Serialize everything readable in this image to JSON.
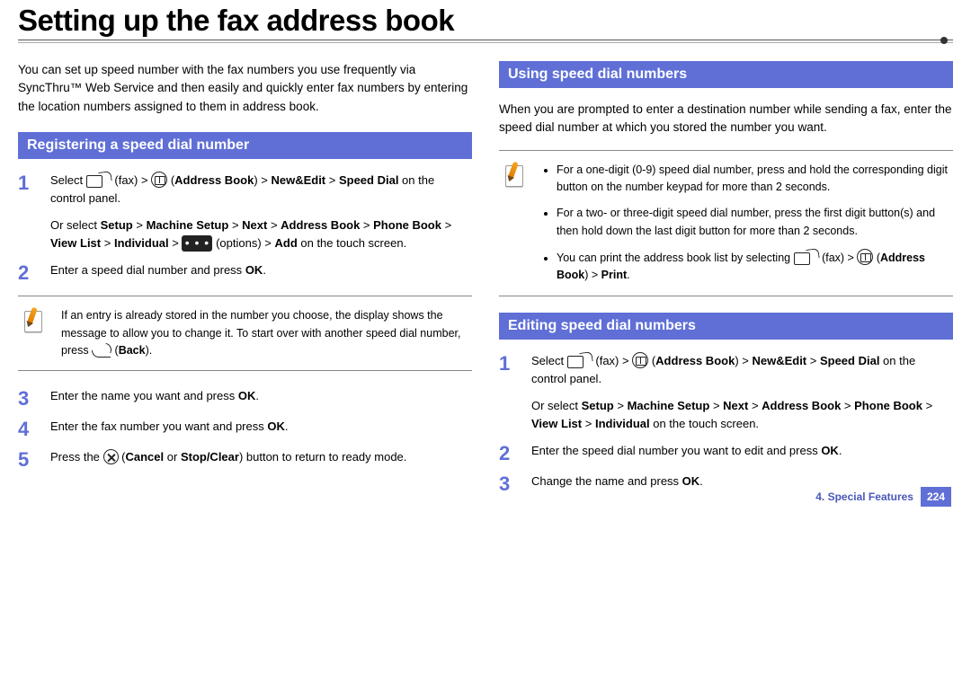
{
  "page_title": "Setting up the fax address book",
  "intro": "You can set up speed number with the fax numbers you use frequently via SyncThru™ Web Service and then easily and quickly enter fax numbers by entering the location numbers assigned to them in address book.",
  "left": {
    "heading": "Registering a speed dial number",
    "steps": [
      {
        "num": "1",
        "parts": {
          "a": "Select ",
          "fax": "(fax) > ",
          "book": "(",
          "bold1": "Address Book",
          "mid1": ") > ",
          "bold2": "New&Edit",
          "mid2": " > ",
          "bold3": "Speed Dial",
          "tail": " on the control panel.",
          "alt_lead": "Or select ",
          "alt_bold1": "Setup",
          "alt_m1": " > ",
          "alt_bold2": "Machine Setup",
          "alt_m2": " > ",
          "alt_bold3": "Next",
          "alt_m3": " > ",
          "alt_bold4": "Address Book",
          "alt_m4": " > ",
          "alt_bold5": "Phone Book",
          "alt_m5": " > ",
          "alt_bold6": "View List",
          "alt_m6": " > ",
          "alt_bold7": "Individual",
          "alt_m7": " > ",
          "alt_opts": "(options) > ",
          "alt_bold8": "Add",
          "alt_tail": " on the touch screen."
        }
      },
      {
        "num": "2",
        "parts": {
          "a": "Enter a speed dial number and press ",
          "b": "OK",
          "c": "."
        }
      },
      {
        "num": "3",
        "parts": {
          "a": "Enter the name you want and press ",
          "b": "OK",
          "c": "."
        }
      },
      {
        "num": "4",
        "parts": {
          "a": "Enter the fax number you want and press ",
          "b": "OK",
          "c": "."
        }
      },
      {
        "num": "5",
        "parts": {
          "a": "Press the ",
          "b": "(",
          "c": "Cancel",
          "d": " or ",
          "e": "Stop/Clear",
          "f": ") button to return to ready mode."
        }
      }
    ],
    "note": {
      "a": "If an entry is already stored in the number you choose, the display shows the message to allow you to change it. To start over with another speed dial number, press ",
      "b": "(",
      "c": "Back",
      "d": ")."
    }
  },
  "right": {
    "heading_use": "Using speed dial numbers",
    "use_intro": "When you are prompted to enter a destination number while sending a fax, enter the speed dial number at which you stored the number you want.",
    "use_note": [
      "For a one-digit (0-9) speed dial number, press and hold the corresponding digit button on the number keypad for more than 2 seconds.",
      "For a two- or three-digit speed dial number, press the first digit button(s) and then hold down the last digit button for more than 2 seconds."
    ],
    "use_note_print": {
      "a": "You can print the address book list by selecting ",
      "fax": "(fax) > ",
      "book": "(",
      "bold": "Address Book",
      "mid": ") > ",
      "bold2": "Print",
      "c": "."
    },
    "heading_edit": "Editing speed dial numbers",
    "edit_steps": [
      {
        "num": "1",
        "parts": {
          "a": "Select ",
          "fax": "(fax) > ",
          "book": "(",
          "bold1": "Address Book",
          "mid1": ") > ",
          "bold2": "New&Edit",
          "mid2": " > ",
          "bold3": "Speed Dial",
          "tail": " on the control panel.",
          "alt_lead": "Or select ",
          "alt_bold1": "Setup",
          "alt_m1": " > ",
          "alt_bold2": "Machine Setup",
          "alt_m2": " > ",
          "alt_bold3": "Next",
          "alt_m3": " > ",
          "alt_bold4": "Address Book",
          "alt_m4": " > ",
          "alt_bold5": "Phone Book",
          "alt_m5": " > ",
          "alt_bold6": "View List",
          "alt_m6": " > ",
          "alt_bold7": "Individual",
          "alt_tail": " on the touch screen."
        }
      },
      {
        "num": "2",
        "parts": {
          "a": "Enter the speed dial number you want to edit and press ",
          "b": "OK",
          "c": "."
        }
      },
      {
        "num": "3",
        "parts": {
          "a": "Change the name and press ",
          "b": "OK",
          "c": "."
        }
      }
    ]
  },
  "footer": {
    "chapter": "4.  Special Features",
    "page": "224"
  }
}
